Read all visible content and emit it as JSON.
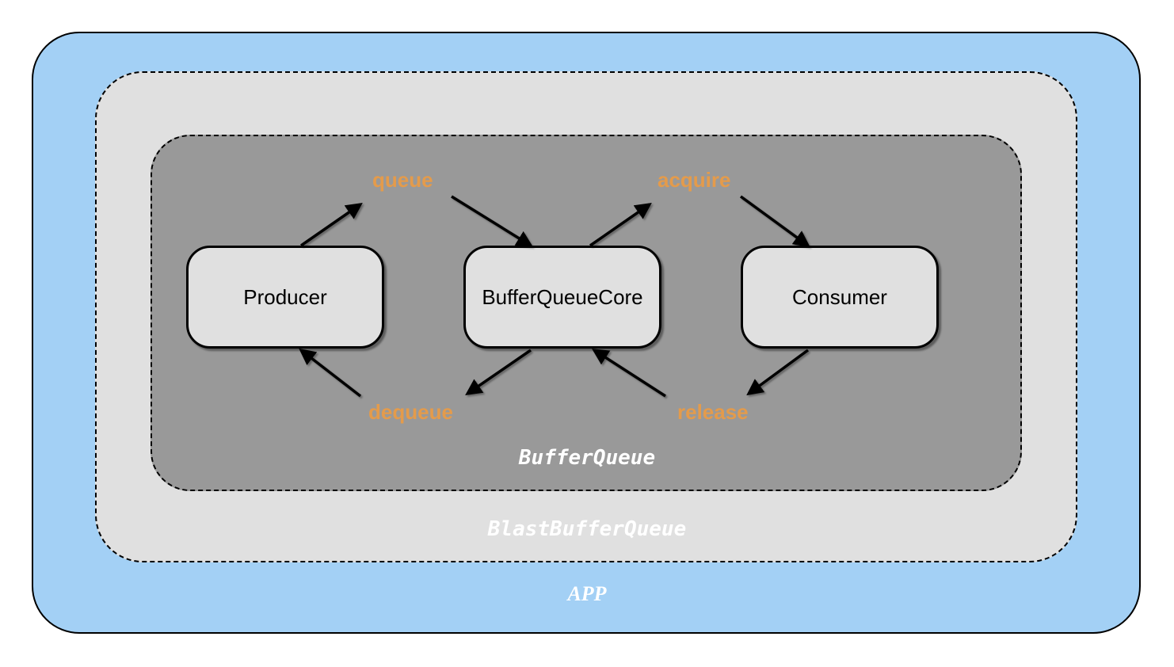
{
  "layers": {
    "outer": "APP",
    "middle": "BlastBufferQueue",
    "inner": "BufferQueue"
  },
  "nodes": {
    "producer": "Producer",
    "core": "BufferQueueCore",
    "consumer": "Consumer"
  },
  "ops": {
    "queue": "queue",
    "acquire": "acquire",
    "dequeue": "dequeue",
    "release": "release"
  }
}
